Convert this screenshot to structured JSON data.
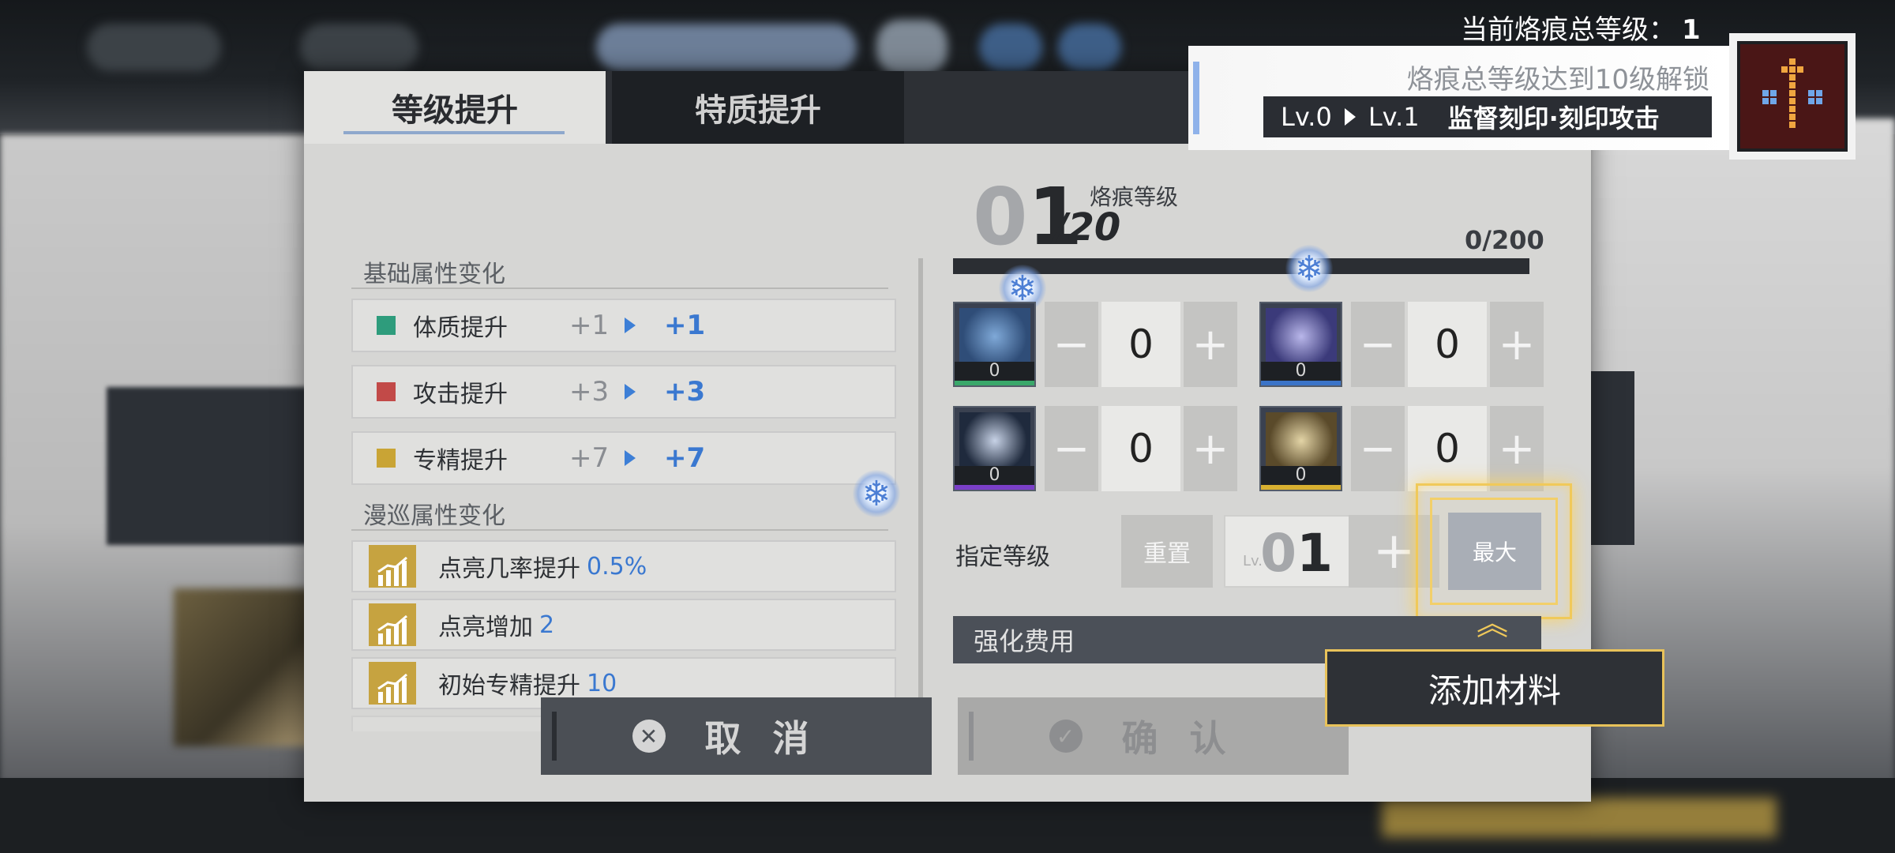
{
  "tabs": [
    {
      "label": "等级提升",
      "active": true
    },
    {
      "label": "特质提升",
      "active": false
    }
  ],
  "basic_section": {
    "title": "基础属性变化",
    "rows": [
      {
        "label": "体质提升",
        "from": "+1",
        "to": "+1",
        "color": "#2e9c7c"
      },
      {
        "label": "攻击提升",
        "from": "+3",
        "to": "+3",
        "color": "#c24a48"
      },
      {
        "label": "专精提升",
        "from": "+7",
        "to": "+7",
        "color": "#c9a435"
      }
    ]
  },
  "roam_section": {
    "title": "漫巡属性变化",
    "rows": [
      {
        "label": "点亮几率提升",
        "value": "0.5%"
      },
      {
        "label": "点亮增加",
        "value": "2"
      },
      {
        "label": "初始专精提升",
        "value": "10"
      }
    ]
  },
  "level": {
    "digit0": "0",
    "digit1": "1",
    "max": "/20",
    "caption": "烙痕等级",
    "exp_text": "0/200",
    "exp_fraction": 0
  },
  "materials": [
    {
      "count": "0",
      "amount": "0",
      "minus": "−",
      "plus": "+",
      "bar_color": "#3aa86a",
      "tint": "#4e8fbf"
    },
    {
      "count": "0",
      "amount": "0",
      "minus": "−",
      "plus": "+",
      "bar_color": "#3b74c8",
      "tint": "#5a5fa8"
    },
    {
      "count": "0",
      "amount": "0",
      "minus": "−",
      "plus": "+",
      "bar_color": "#7a3fc8",
      "tint": "#2b3a55"
    },
    {
      "count": "0",
      "amount": "0",
      "minus": "−",
      "plus": "+",
      "bar_color": "#d8b030",
      "tint": "#8a7448"
    }
  ],
  "specify": {
    "label": "指定等级",
    "reset_label": "重置",
    "lv_prefix": "Lv.",
    "digit0": "0",
    "digit1": "1",
    "plus": "+",
    "max_label": "最大"
  },
  "cost_label": "强化费用",
  "buttons": {
    "cancel": "取消",
    "confirm": "确认",
    "cancel_icon": "✕",
    "confirm_icon": "✓"
  },
  "tooltip": {
    "text": "添加材料",
    "arrow": "︽"
  },
  "overlay": {
    "total_level_label": "当前烙痕总等级：",
    "total_level_value": "1",
    "unlock_hint": "烙痕总等级达到10级解锁",
    "from_level": "Lv.0",
    "to_level": "Lv.1",
    "skill_name": "监督刻印·刻印攻击"
  },
  "icons": {
    "sparkle": "sparkle-icon",
    "chart": "bar-chart-icon",
    "emblem": "arrow-pixel-emblem-icon"
  }
}
